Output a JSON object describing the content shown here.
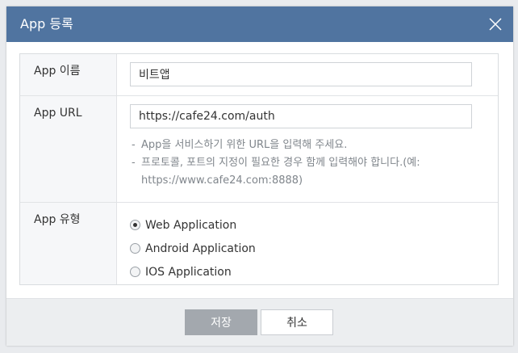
{
  "dialog": {
    "title": "App 등록",
    "close_icon": "close-icon"
  },
  "form": {
    "name": {
      "label": "App 이름",
      "value": "비트앱"
    },
    "url": {
      "label": "App URL",
      "value": "https://cafe24.com/auth",
      "help": [
        "App을 서비스하기 위한 URL을 입력해 주세요.",
        "프로토콜, 포트의 지정이 필요한 경우 함께 입력해야 합니다.(예:",
        "https://www.cafe24.com:8888)"
      ]
    },
    "type": {
      "label": "App 유형",
      "options": [
        {
          "label": "Web Application",
          "checked": true
        },
        {
          "label": "Android Application",
          "checked": false
        },
        {
          "label": "IOS Application",
          "checked": false
        }
      ]
    }
  },
  "footer": {
    "save_label": "저장",
    "cancel_label": "취소"
  },
  "colors": {
    "header_bg": "#5074a0",
    "save_btn_bg": "#a3a8ae"
  }
}
